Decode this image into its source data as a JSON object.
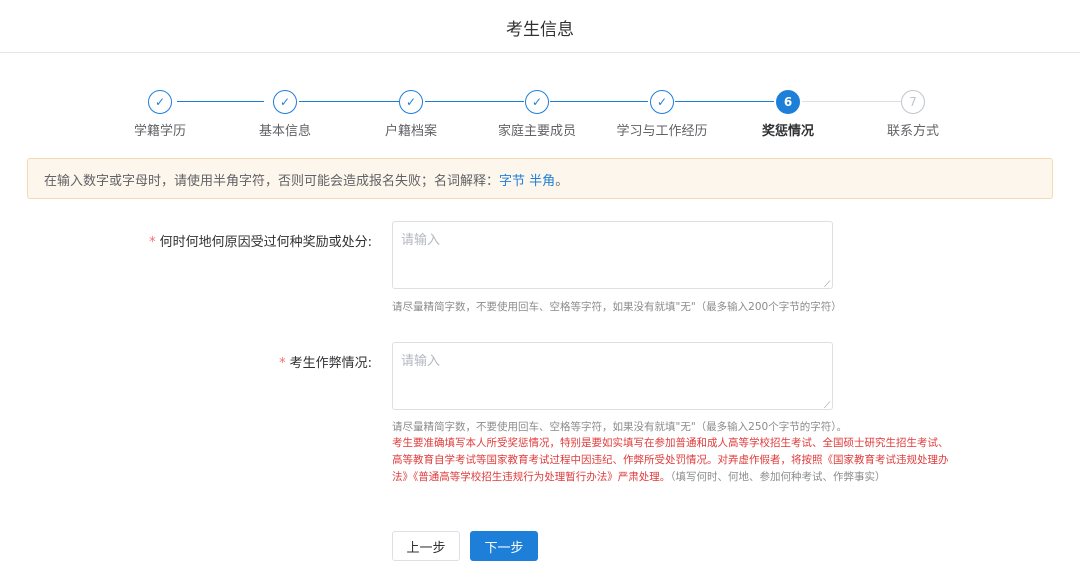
{
  "header": {
    "title": "考生信息"
  },
  "steps": [
    {
      "label": "学籍学历",
      "status": "done",
      "icon": "check-icon",
      "marker": "✓"
    },
    {
      "label": "基本信息",
      "status": "done",
      "icon": "check-icon",
      "marker": "✓"
    },
    {
      "label": "户籍档案",
      "status": "done",
      "icon": "check-icon",
      "marker": "✓"
    },
    {
      "label": "家庭主要成员",
      "status": "done",
      "icon": "check-icon",
      "marker": "✓"
    },
    {
      "label": "学习与工作经历",
      "status": "done",
      "icon": "check-icon",
      "marker": "✓"
    },
    {
      "label": "奖惩情况",
      "status": "active",
      "marker": "6"
    },
    {
      "label": "联系方式",
      "status": "todo",
      "marker": "7"
    }
  ],
  "notice": {
    "text": "在输入数字或字母时，请使用半角字符，否则可能会造成报名失败；名词解释：",
    "link1": "字节",
    "link2": "半角",
    "end": "。"
  },
  "form": {
    "rewards": {
      "required_mark": "*",
      "label": "何时何地何原因受过何种奖励或处分:",
      "placeholder": "请输入",
      "hint": "请尽量精简字数，不要使用回车、空格等字符，如果没有就填\"无\"（最多输入200个字节的字符）"
    },
    "cheating": {
      "required_mark": "*",
      "label": "考生作弊情况:",
      "placeholder": "请输入",
      "hint": "请尽量精简字数，不要使用回车、空格等字符，如果没有就填\"无\"（最多输入250个字节的字符）。",
      "warning_red": "考生要准确填写本人所受奖惩情况，特别是要如实填写在参加普通和成人高等学校招生考试、全国硕士研究生招生考试、高等教育自学考试等国家教育考试过程中因违纪、作弊所受处罚情况。对弄虚作假者，将按照《国家教育考试违规处理办法》《普通高等学校招生违规行为处理暂行办法》严肃处理。",
      "warning_gray": "（填写何时、何地、参加何种考试、作弊事实）"
    }
  },
  "buttons": {
    "prev": "上一步",
    "next": "下一步"
  },
  "colors": {
    "primary": "#1e7fd9",
    "required": "#f56c6c",
    "warning": "#e03b3b",
    "notice_bg": "#fdf6ec"
  }
}
